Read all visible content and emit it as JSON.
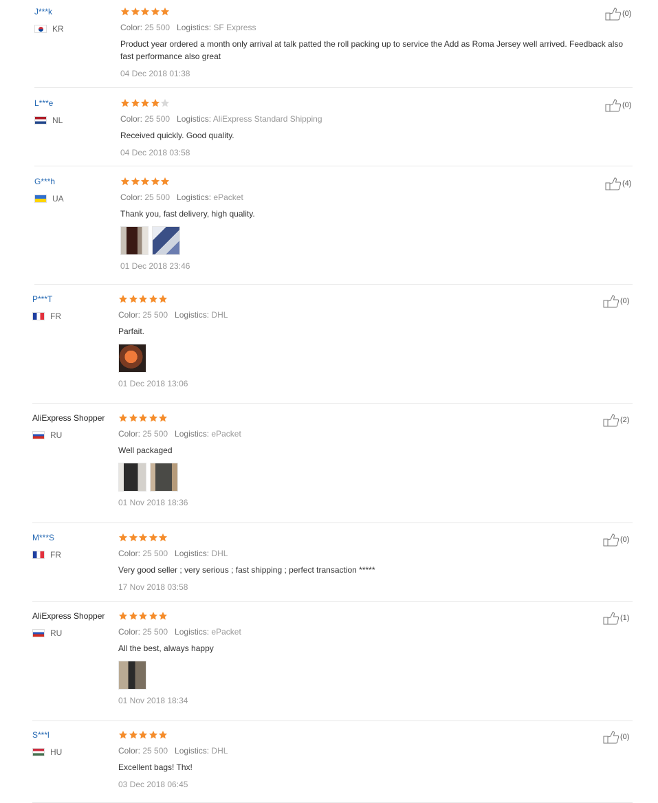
{
  "colors": {
    "accent": "#2468b3",
    "star": "#f58d2c",
    "star_empty": "#d9d9d9",
    "divider": "#e8e8e8"
  },
  "labels": {
    "color": "Color:",
    "logistics": "Logistics:"
  },
  "reviews": [
    {
      "user": "J***k",
      "country": "KR",
      "flag": "kr",
      "rating": 5,
      "color": "25 500",
      "logistics": "SF Express",
      "text": "Product year ordered a month only arrival at talk patted the roll packing up to service the Add as Roma Jersey well arrived. Feedback also fast performance also great",
      "photos": [],
      "date": "04 Dec 2018 01:38",
      "helpful": "(0)"
    },
    {
      "user": "L***e",
      "country": "NL",
      "flag": "nl",
      "rating": 4,
      "color": "25 500",
      "logistics": "AliExpress Standard Shipping",
      "text": "Received quickly. Good quality.",
      "photos": [],
      "date": "04 Dec 2018 03:58",
      "helpful": "(0)"
    },
    {
      "user": "G***h",
      "country": "UA",
      "flag": "ua",
      "rating": 5,
      "color": "25 500",
      "logistics": "ePacket",
      "text": "Thank you, fast delivery, high quality.",
      "photos": [
        "photo-dark-bag",
        "photo-blue-package"
      ],
      "date": "01 Dec 2018 23:46",
      "helpful": "(4)"
    },
    {
      "user": "P***T",
      "country": "FR",
      "flag": "fr",
      "rating": 5,
      "color": "25 500",
      "logistics": "DHL",
      "text": "Parfait.",
      "photos": [
        "photo-orange-bag"
      ],
      "date": "01 Dec 2018 13:06",
      "helpful": "(0)"
    },
    {
      "user": "AliExpress Shopper",
      "country": "RU",
      "flag": "ru",
      "rating": 5,
      "color": "25 500",
      "logistics": "ePacket",
      "text": "Well packaged",
      "photos": [
        "photo-black-bag",
        "photo-package-brown"
      ],
      "date": "01 Nov 2018 18:36",
      "helpful": "(2)"
    },
    {
      "user": "M***S",
      "country": "FR",
      "flag": "fr",
      "rating": 5,
      "color": "25 500",
      "logistics": "DHL",
      "text": "Very good seller ; very serious ; fast shipping ; perfect transaction *****",
      "photos": [],
      "date": "17 Nov 2018 03:58",
      "helpful": "(0)"
    },
    {
      "user": "AliExpress Shopper",
      "country": "RU",
      "flag": "ru",
      "rating": 5,
      "color": "25 500",
      "logistics": "ePacket",
      "text": "All the best, always happy",
      "photos": [
        "photo-bag-closeup"
      ],
      "date": "01 Nov 2018 18:34",
      "helpful": "(1)"
    },
    {
      "user": "S***l",
      "country": "HU",
      "flag": "hu",
      "rating": 5,
      "color": "25 500",
      "logistics": "DHL",
      "text": "Excellent bags! Thx!",
      "photos": [],
      "date": "03 Dec 2018 06:45",
      "helpful": "(0)"
    }
  ]
}
